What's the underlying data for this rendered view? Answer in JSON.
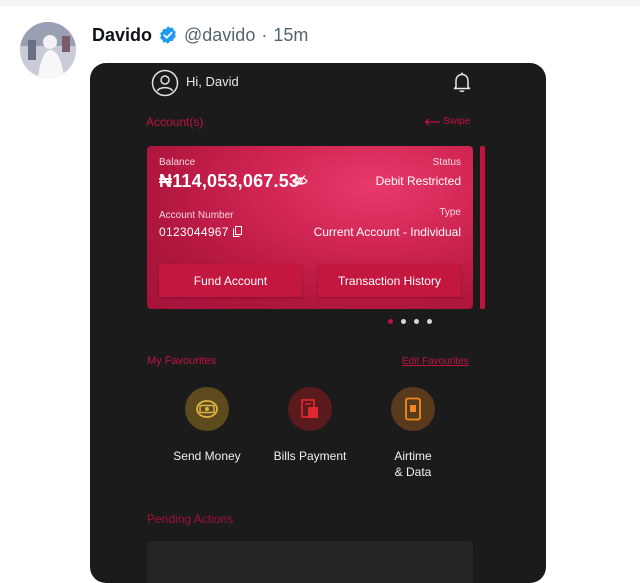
{
  "tweet": {
    "name": "Davido",
    "handle": "@davido",
    "separator": "·",
    "time": "15m"
  },
  "app": {
    "greeting": "Hi, David",
    "accounts_title": "Account(s)",
    "swipe_label": "Swipe",
    "card": {
      "balance_label": "Balance",
      "balance_value": "₦114,053,067.53",
      "status_label": "Status",
      "status_value": "Debit Restricted",
      "account_number_label": "Account Number",
      "account_number_value": "0123044967",
      "type_label": "Type",
      "type_value": "Current Account - Individual",
      "fund_button": "Fund Account",
      "history_button": "Transaction History"
    },
    "pager": {
      "count": 4,
      "active_index": 0
    },
    "favourites": {
      "title": "My Favourites",
      "edit_link": "Edit Favourites",
      "items": [
        {
          "label": "Send Money",
          "icon": "send-money-icon",
          "color": "#e0b347"
        },
        {
          "label": "Bills Payment",
          "icon": "bills-icon",
          "color": "#e0262f"
        },
        {
          "label": "Airtime\n& Data",
          "icon": "airtime-icon",
          "color": "#ef8a23"
        }
      ]
    },
    "pending_title": "Pending Actions"
  },
  "colors": {
    "accent": "#c0133f",
    "verified": "#1d9bf0",
    "app_bg": "#1c1b1c"
  }
}
